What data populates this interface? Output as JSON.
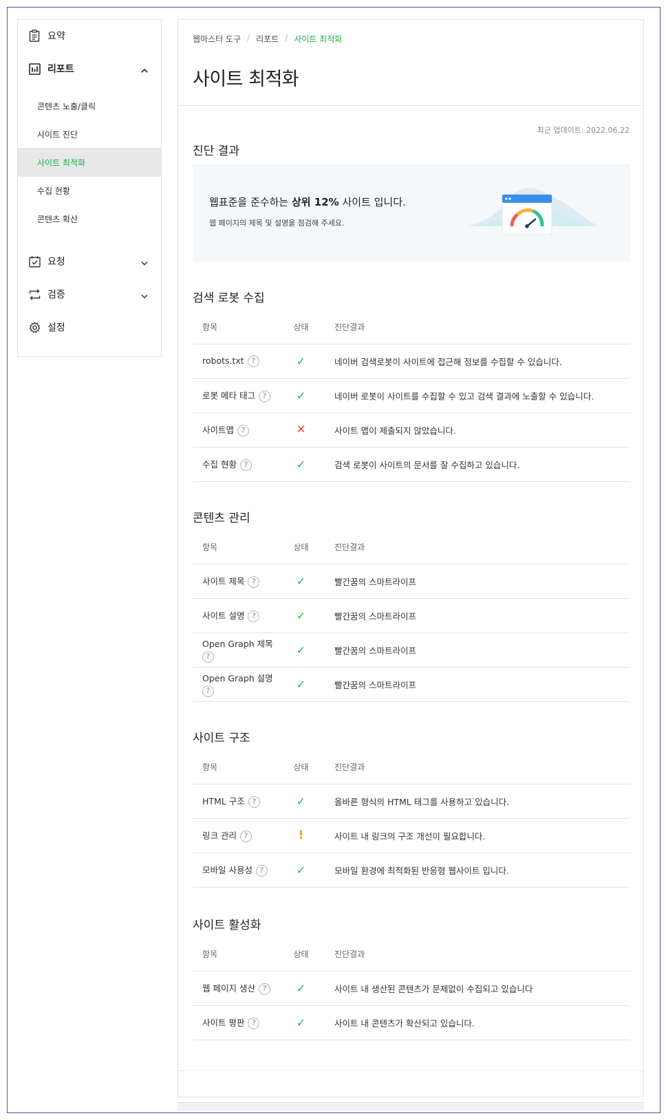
{
  "sidebar": {
    "summary": "요약",
    "report": "리포트",
    "report_sub": [
      "콘텐츠 노출/클릭",
      "사이트 진단",
      "사이트 최적화",
      "수집 현황",
      "콘텐츠 확산"
    ],
    "request": "요청",
    "verify": "검증",
    "settings": "설정"
  },
  "breadcrumb": [
    "웹마스터 도구",
    "리포트",
    "사이트 최적화"
  ],
  "page_title": "사이트 최적화",
  "updated": "최근 업데이트: 2022.06.22",
  "result": {
    "title": "진단 결과",
    "line1_pre": "웹표준을 준수하는 ",
    "line1_bold": "상위 12%",
    "line1_post": " 사이트 입니다.",
    "line2": "웹 페이지의 제목 및 설명을 점검해 주세요."
  },
  "headers": {
    "item": "항목",
    "status": "상태",
    "result": "진단결과"
  },
  "sections": [
    {
      "title": "검색 로봇 수집",
      "rows": [
        {
          "item": "robots.txt",
          "status": "ok",
          "result": "네이버 검색로봇이 사이트에 접근해 정보를 수집할 수 있습니다."
        },
        {
          "item": "로봇 메타 태그",
          "status": "ok",
          "result": "네이버 로봇이 사이트를 수집할 수 있고 검색 결과에 노출할 수 있습니다."
        },
        {
          "item": "사이트맵",
          "status": "fail",
          "result": "사이트 맵이 제출되지 않았습니다."
        },
        {
          "item": "수집 현황",
          "status": "ok",
          "result": "검색 로봇이 사이트의 문서를 잘 수집하고 있습니다."
        }
      ]
    },
    {
      "title": "콘텐츠 관리",
      "rows": [
        {
          "item": "사이트 제목",
          "status": "ok",
          "result": "빨간꿈의 스마트라이프"
        },
        {
          "item": "사이트 설명",
          "status": "ok",
          "result": "빨간꿈의 스마트라이프"
        },
        {
          "item": "Open Graph 제목",
          "status": "ok",
          "result": "빨간꿈의 스마트라이프"
        },
        {
          "item": "Open Graph 설명",
          "status": "ok",
          "result": "빨간꿈의 스마트라이프"
        }
      ]
    },
    {
      "title": "사이트 구조",
      "rows": [
        {
          "item": "HTML 구조",
          "status": "ok",
          "result": "올바른 형식의 HTML 태그를 사용하고 있습니다."
        },
        {
          "item": "링크 관리",
          "status": "warn",
          "result": "사이트 내 링크의 구조 개선이 필요합니다."
        },
        {
          "item": "모바일 사용성",
          "status": "ok",
          "result": "모바일 환경에 최적화된 반응형 웹사이트 입니다."
        }
      ]
    },
    {
      "title": "사이트 활성화",
      "rows": [
        {
          "item": "웹 페이지 생산",
          "status": "ok",
          "result": "사이트 내 생산된 콘텐츠가 문제없이 수집되고 있습니다"
        },
        {
          "item": "사이트 평판",
          "status": "ok",
          "result": "사이트 내 콘텐츠가 확산되고 있습니다."
        }
      ]
    }
  ],
  "status_glyphs": {
    "ok": "✓",
    "fail": "✕",
    "warn": "!"
  },
  "colors": {
    "accent": "#19b34a",
    "error": "#f04848",
    "warning": "#f59a23"
  }
}
